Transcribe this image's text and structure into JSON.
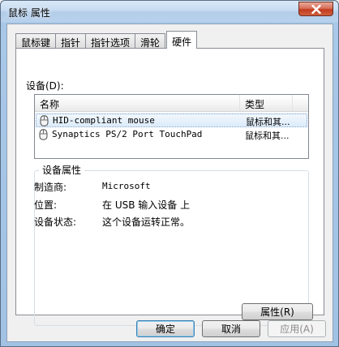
{
  "window": {
    "title": "鼠标 属性"
  },
  "tabs": [
    {
      "label": "鼠标键"
    },
    {
      "label": "指针"
    },
    {
      "label": "指针选项"
    },
    {
      "label": "滑轮"
    },
    {
      "label": "硬件"
    }
  ],
  "devices": {
    "label": "设备(D):",
    "columns": {
      "name": "名称",
      "type": "类型"
    },
    "rows": [
      {
        "name": "HID-compliant mouse",
        "type": "鼠标和其...",
        "selected": true
      },
      {
        "name": "Synaptics PS/2 Port TouchPad",
        "type": "鼠标和其...",
        "selected": false
      }
    ]
  },
  "device_properties": {
    "title": "设备属性",
    "manufacturer_label": "制造商:",
    "manufacturer": "Microsoft",
    "location_label": "位置:",
    "location": "在 USB 输入设备 上",
    "status_label": "设备状态:",
    "status": "这个设备运转正常。"
  },
  "buttons": {
    "properties": "属性(R)",
    "ok": "确定",
    "cancel": "取消",
    "apply": "应用(A)"
  }
}
